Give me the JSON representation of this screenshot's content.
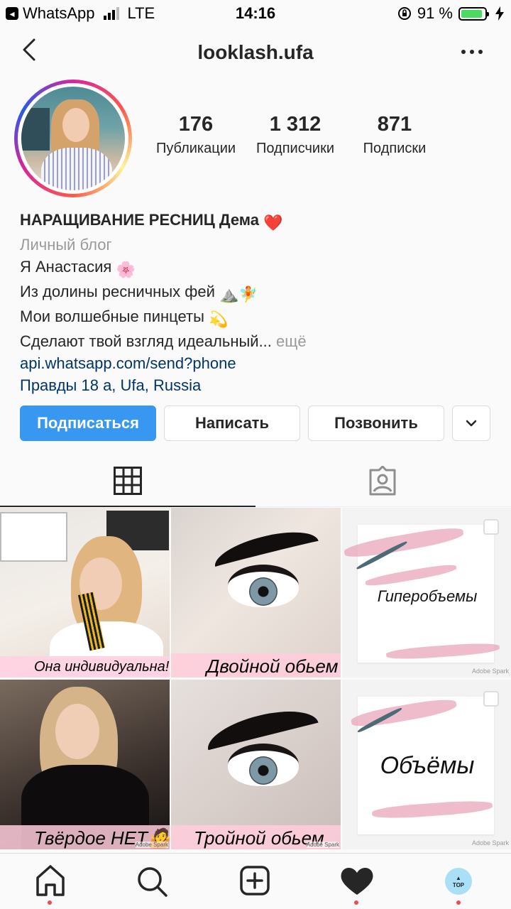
{
  "status_bar": {
    "app": "WhatsApp",
    "network": "LTE",
    "time": "14:16",
    "battery": "91 %",
    "battery_fraction": 0.91
  },
  "header": {
    "username": "looklash.ufa"
  },
  "stats": [
    {
      "value": "176",
      "label": "Публикации"
    },
    {
      "value": "1 312",
      "label": "Подписчики"
    },
    {
      "value": "871",
      "label": "Подписки"
    }
  ],
  "bio": {
    "name": "НАРАЩИВАНИЕ РЕСНИЦ Дема",
    "name_emoji": "❤️",
    "category": "Личный блог",
    "line1": "Я Анастасия",
    "line1_emoji": "🌸",
    "line2": "Из долины ресничных фей",
    "line2_emoji": "⛰️🧚",
    "line3": "Мои волшебные пинцеты",
    "line3_emoji": "💫",
    "line4": "Сделают твой взгляд идеальный...",
    "more": "ещё",
    "link": "api.whatsapp.com/send?phone",
    "address": "Правды 18 а, Ufa, Russia"
  },
  "actions": {
    "follow": "Подписаться",
    "message": "Написать",
    "call": "Позвонить"
  },
  "posts": [
    {
      "caption": "Она индивидуальна!!!"
    },
    {
      "caption": "Двойной обьем"
    },
    {
      "caption": "Гиперобъемы",
      "watermark": "Adobe Spark"
    },
    {
      "caption": "Твёрдое НЕТ🤷",
      "watermark": "Adobe Spark"
    },
    {
      "caption": "Тройной обьем",
      "watermark": "Adobe Spark"
    },
    {
      "caption": "Объёмы",
      "watermark": "Adobe Spark"
    }
  ],
  "post_small_watermark": "Adobe Spark",
  "bottom_nav": {
    "top_badge": "TOP"
  },
  "colors": {
    "follow_button": "#3897f0",
    "link": "#003569",
    "notification_dot": "#ed4956",
    "battery": "#4cd964"
  },
  "icons": [
    "back-arrow-icon",
    "more-icon",
    "grid-icon",
    "tagged-icon",
    "home-icon",
    "search-icon",
    "add-icon",
    "heart-icon",
    "chevron-down-icon"
  ]
}
